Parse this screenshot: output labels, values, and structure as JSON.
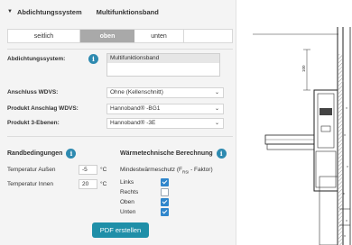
{
  "header": {
    "title": "Abdichtungssystem",
    "value": "Multifunktionsband"
  },
  "tabs": [
    {
      "label": "seitlich"
    },
    {
      "label": "oben",
      "active": true
    },
    {
      "label": "unten"
    }
  ],
  "form": {
    "abdichtung_label": "Abdichtungssystem:",
    "abdichtung_option": "Multifunktionsband",
    "wdvs_label": "Anschluss WDVS:",
    "wdvs_value": "Ohne (Kellenschnitt)",
    "anschlag_label": "Produkt Anschlag WDVS:",
    "anschlag_value": "Hannoband® -BG1",
    "ebenen_label": "Produkt 3-Ebenen:",
    "ebenen_value": "Hannoband® -3E"
  },
  "randbedingungen": {
    "title": "Randbedingungen",
    "temp_aussen_label": "Temperatur Außen",
    "temp_aussen_value": "-5",
    "temp_innen_label": "Temperatur Innen",
    "temp_innen_value": "20",
    "unit": "°C"
  },
  "waerme": {
    "title": "Wärmetechnische Berechnung",
    "subtitle_prefix": "Mindestwärmeschutz (F",
    "subtitle_sub": "RSi",
    "subtitle_suffix": " - Faktor)",
    "options": [
      {
        "label": "Links",
        "checked": true
      },
      {
        "label": "Rechts",
        "checked": false
      },
      {
        "label": "Oben",
        "checked": true
      },
      {
        "label": "Unten",
        "checked": true
      }
    ]
  },
  "button": {
    "label": "PDF erstellen"
  },
  "drawing": {
    "dimension_label": "100"
  },
  "colors": {
    "accent": "#1f8fa8",
    "checkbox": "#2f86cc",
    "info": "#2e8ab0",
    "active_tab": "#a9a9a9"
  }
}
